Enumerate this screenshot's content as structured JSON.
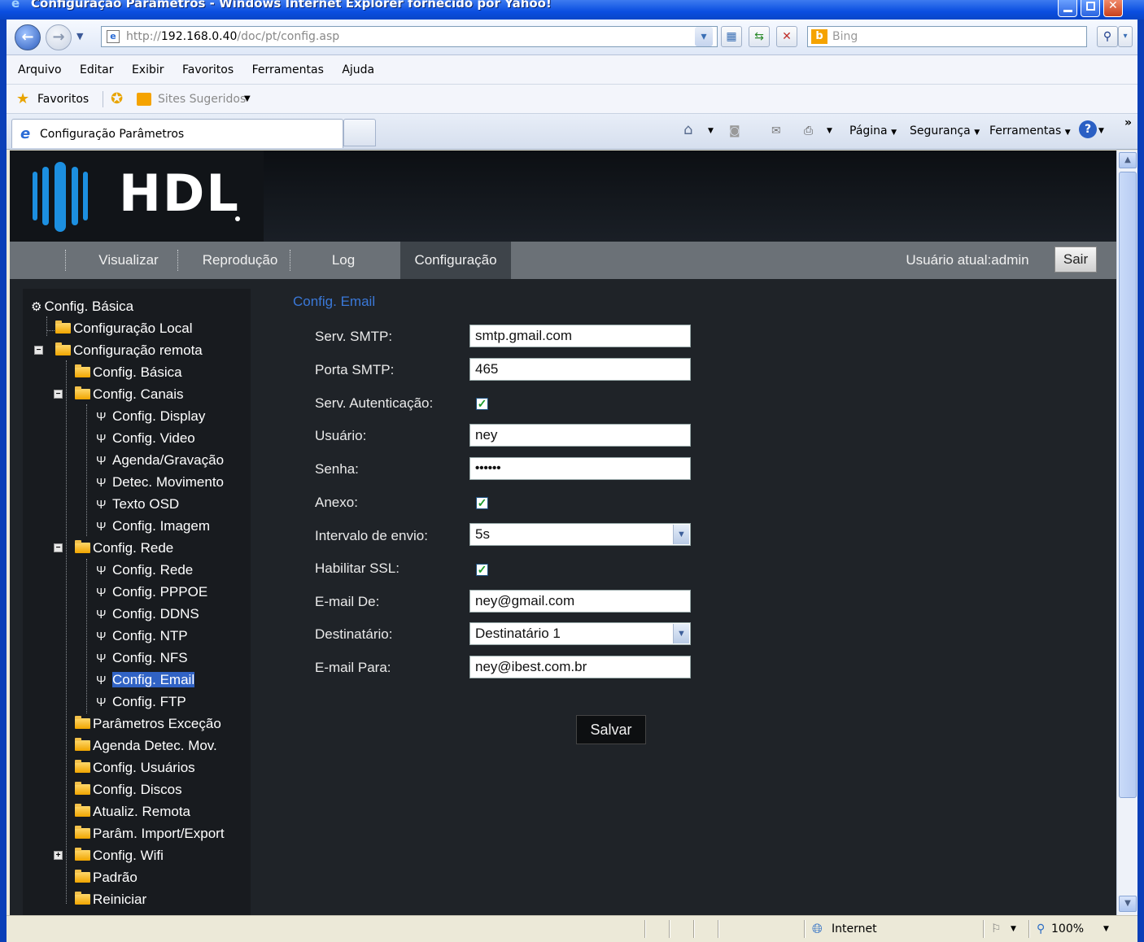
{
  "window": {
    "title": "Configuração Parâmetros - Windows Internet Explorer fornecido por Yahoo!"
  },
  "address": {
    "url_prefix": "http://",
    "url_host": "192.168.0.40",
    "url_path": "/doc/pt/config.asp",
    "search_placeholder": "Bing"
  },
  "menu": [
    "Arquivo",
    "Editar",
    "Exibir",
    "Favoritos",
    "Ferramentas",
    "Ajuda"
  ],
  "favbar": {
    "favorites": "Favoritos",
    "suggested": "Sites Sugeridos"
  },
  "tab": {
    "title": "Configuração Parâmetros"
  },
  "commandbar": {
    "page": "Página",
    "security": "Segurança",
    "tools": "Ferramentas"
  },
  "brand": {
    "logo_text": "HDL"
  },
  "nav": {
    "items": [
      "Visualizar",
      "Reprodução",
      "Log",
      "Configuração"
    ],
    "active": "Configuração",
    "user": "Usuário atual:admin",
    "logout": "Sair"
  },
  "tree": [
    "Config. Básica",
    "Configuração Local",
    "Configuração remota",
    "Config. Básica",
    "Config. Canais",
    "Config. Display",
    "Config. Video",
    "Agenda/Gravação",
    "Detec. Movimento",
    "Texto OSD",
    "Config. Imagem",
    "Config. Rede",
    "Config. Rede",
    "Config. PPPOE",
    "Config. DDNS",
    "Config. NTP",
    "Config. NFS",
    "Config. Email",
    "Config. FTP",
    "Parâmetros Exceção",
    "Agenda Detec. Mov.",
    "Config. Usuários",
    "Config. Discos",
    "Atualiz. Remota",
    "Parâm. Import/Export",
    "Config. Wifi",
    "Padrão",
    "Reiniciar"
  ],
  "form": {
    "title": "Config. Email",
    "smtp_label": "Serv. SMTP:",
    "smtp_value": "smtp.gmail.com",
    "port_label": "Porta SMTP:",
    "port_value": "465",
    "auth_label": "Serv. Autenticação:",
    "auth_checked": true,
    "user_label": "Usuário:",
    "user_value": "ney",
    "password_label": "Senha:",
    "password_value": "••••••",
    "attach_label": "Anexo:",
    "attach_checked": true,
    "interval_label": "Intervalo de envio:",
    "interval_value": "5s",
    "ssl_label": "Habilitar SSL:",
    "ssl_checked": true,
    "from_label": "E-mail De:",
    "from_value": "ney@gmail.com",
    "recipient_label": "Destinatário:",
    "recipient_value": "Destinatário 1",
    "to_label": "E-mail Para:",
    "to_value": "ney@ibest.com.br",
    "save": "Salvar"
  },
  "status": {
    "zone": "Internet",
    "zoom": "100%"
  },
  "colors": {
    "accent": "#3a78d8",
    "nav_bg": "#6b7177",
    "content_bg": "#1f2328",
    "selection": "#3163c5"
  }
}
